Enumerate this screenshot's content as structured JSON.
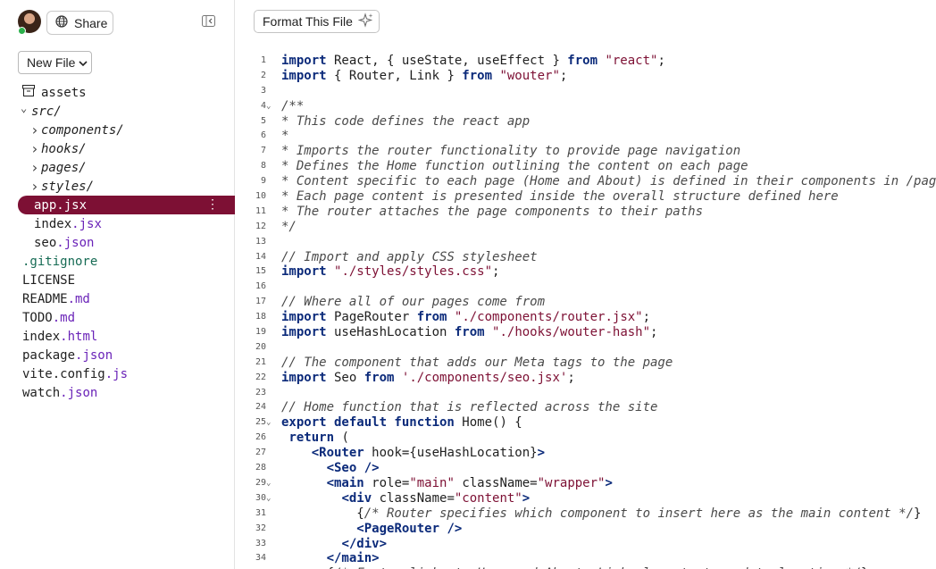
{
  "sidebar": {
    "share_label": "Share",
    "new_file_label": "New File",
    "tree": [
      {
        "indent": 0,
        "type": "dir-icon",
        "name": "assets",
        "ext": ""
      },
      {
        "indent": 0,
        "type": "open-folder",
        "name": "src/",
        "ext": ""
      },
      {
        "indent": 1,
        "type": "closed-folder",
        "name": "components/",
        "ext": ""
      },
      {
        "indent": 1,
        "type": "closed-folder",
        "name": "hooks/",
        "ext": ""
      },
      {
        "indent": 1,
        "type": "closed-folder",
        "name": "pages/",
        "ext": ""
      },
      {
        "indent": 1,
        "type": "closed-folder",
        "name": "styles/",
        "ext": ""
      },
      {
        "indent": 1,
        "type": "selected",
        "name": "app",
        "ext": ".jsx"
      },
      {
        "indent": 1,
        "type": "file",
        "name": "index",
        "ext": ".jsx"
      },
      {
        "indent": 1,
        "type": "file",
        "name": "seo",
        "ext": ".json"
      },
      {
        "indent": 0,
        "type": "gitignore",
        "name": ".gitignore",
        "ext": ""
      },
      {
        "indent": 0,
        "type": "file",
        "name": "LICENSE",
        "ext": ""
      },
      {
        "indent": 0,
        "type": "file",
        "name": "README",
        "ext": ".md"
      },
      {
        "indent": 0,
        "type": "file",
        "name": "TODO",
        "ext": ".md"
      },
      {
        "indent": 0,
        "type": "file",
        "name": "index",
        "ext": ".html"
      },
      {
        "indent": 0,
        "type": "file",
        "name": "package",
        "ext": ".json"
      },
      {
        "indent": 0,
        "type": "file",
        "name": "vite.config",
        "ext": ".js"
      },
      {
        "indent": 0,
        "type": "file",
        "name": "watch",
        "ext": ".json"
      }
    ]
  },
  "editor": {
    "format_label": "Format This File",
    "lines": [
      {
        "n": "1",
        "fold": "",
        "tokens": [
          [
            "kw",
            "import"
          ],
          [
            "",
            "  React, { useState, useEffect } "
          ],
          [
            "kw",
            "from"
          ],
          [
            "",
            " "
          ],
          [
            "str",
            "\"react\""
          ],
          [
            "",
            ";"
          ]
        ]
      },
      {
        "n": "2",
        "fold": "",
        "tokens": [
          [
            "kw",
            "import"
          ],
          [
            "",
            " { Router, Link } "
          ],
          [
            "kw",
            "from"
          ],
          [
            "",
            " "
          ],
          [
            "str",
            "\"wouter\""
          ],
          [
            "",
            ";"
          ]
        ]
      },
      {
        "n": "3",
        "fold": "",
        "tokens": []
      },
      {
        "n": "4",
        "fold": "v",
        "tokens": [
          [
            "cm",
            "/**"
          ]
        ]
      },
      {
        "n": "5",
        "fold": "",
        "tokens": [
          [
            "cm",
            "* This code defines the react app"
          ]
        ]
      },
      {
        "n": "6",
        "fold": "",
        "tokens": [
          [
            "cm",
            "*"
          ]
        ]
      },
      {
        "n": "7",
        "fold": "",
        "tokens": [
          [
            "cm",
            "* Imports the router functionality to provide page navigation"
          ]
        ]
      },
      {
        "n": "8",
        "fold": "",
        "tokens": [
          [
            "cm",
            "* Defines the Home function outlining the content on each page"
          ]
        ]
      },
      {
        "n": "9",
        "fold": "",
        "tokens": [
          [
            "cm",
            "* Content specific to each page (Home and About) is defined in their components in /pages"
          ]
        ]
      },
      {
        "n": "10",
        "fold": "",
        "tokens": [
          [
            "cm",
            "* Each page content is presented inside the overall structure defined here"
          ]
        ]
      },
      {
        "n": "11",
        "fold": "",
        "tokens": [
          [
            "cm",
            "* The router attaches the page components to their paths"
          ]
        ]
      },
      {
        "n": "12",
        "fold": "",
        "tokens": [
          [
            "cm",
            "*/"
          ]
        ]
      },
      {
        "n": "13",
        "fold": "",
        "tokens": []
      },
      {
        "n": "14",
        "fold": "",
        "tokens": [
          [
            "cm",
            "// Import and apply CSS stylesheet"
          ]
        ]
      },
      {
        "n": "15",
        "fold": "",
        "tokens": [
          [
            "kw",
            "import"
          ],
          [
            "",
            " "
          ],
          [
            "str",
            "\"./styles/styles.css\""
          ],
          [
            "",
            ";"
          ]
        ]
      },
      {
        "n": "16",
        "fold": "",
        "tokens": []
      },
      {
        "n": "17",
        "fold": "",
        "tokens": [
          [
            "cm",
            "// Where all of our pages come from"
          ]
        ]
      },
      {
        "n": "18",
        "fold": "",
        "tokens": [
          [
            "kw",
            "import"
          ],
          [
            "",
            " PageRouter "
          ],
          [
            "kw",
            "from"
          ],
          [
            "",
            " "
          ],
          [
            "str",
            "\"./components/router.jsx\""
          ],
          [
            "",
            ";"
          ]
        ]
      },
      {
        "n": "19",
        "fold": "",
        "tokens": [
          [
            "kw",
            "import"
          ],
          [
            "",
            " useHashLocation "
          ],
          [
            "kw",
            "from"
          ],
          [
            "",
            " "
          ],
          [
            "str",
            "\"./hooks/wouter-hash\""
          ],
          [
            "",
            ";"
          ]
        ]
      },
      {
        "n": "20",
        "fold": "",
        "tokens": []
      },
      {
        "n": "21",
        "fold": "",
        "tokens": [
          [
            "cm",
            "// The component that adds our Meta tags to the page"
          ]
        ]
      },
      {
        "n": "22",
        "fold": "",
        "tokens": [
          [
            "kw",
            "import"
          ],
          [
            "",
            " Seo "
          ],
          [
            "kw",
            "from"
          ],
          [
            "",
            " "
          ],
          [
            "str",
            "'./components/seo.jsx'"
          ],
          [
            "",
            ";"
          ]
        ]
      },
      {
        "n": "23",
        "fold": "",
        "tokens": []
      },
      {
        "n": "24",
        "fold": "",
        "tokens": [
          [
            "cm",
            "// Home function that is reflected across the site"
          ]
        ]
      },
      {
        "n": "25",
        "fold": "v",
        "tokens": [
          [
            "kw",
            "export default function"
          ],
          [
            "",
            " Home() {"
          ]
        ]
      },
      {
        "n": "26",
        "fold": "",
        "tokens": [
          [
            "",
            " "
          ],
          [
            "kw",
            "return"
          ],
          [
            "",
            " ("
          ]
        ]
      },
      {
        "n": "27",
        "fold": "",
        "tokens": [
          [
            "",
            "    "
          ],
          [
            "tag",
            "<Router"
          ],
          [
            "",
            " hook={useHashLocation}"
          ],
          [
            "tag",
            ">"
          ]
        ]
      },
      {
        "n": "28",
        "fold": "",
        "tokens": [
          [
            "",
            "      "
          ],
          [
            "tag",
            "<Seo />"
          ]
        ]
      },
      {
        "n": "29",
        "fold": "v",
        "tokens": [
          [
            "",
            "      "
          ],
          [
            "tag",
            "<main"
          ],
          [
            "",
            " role="
          ],
          [
            "str",
            "\"main\""
          ],
          [
            "",
            " className="
          ],
          [
            "str",
            "\"wrapper\""
          ],
          [
            "tag",
            ">"
          ]
        ]
      },
      {
        "n": "30",
        "fold": "v",
        "tokens": [
          [
            "",
            "        "
          ],
          [
            "tag",
            "<div"
          ],
          [
            "",
            " className="
          ],
          [
            "str",
            "\"content\""
          ],
          [
            "tag",
            ">"
          ]
        ]
      },
      {
        "n": "31",
        "fold": "",
        "tokens": [
          [
            "",
            "          {"
          ],
          [
            "cm",
            "/* Router specifies which component to insert here as the main content */"
          ],
          [
            "",
            "}"
          ]
        ]
      },
      {
        "n": "32",
        "fold": "",
        "tokens": [
          [
            "",
            "          "
          ],
          [
            "tag",
            "<PageRouter />"
          ]
        ]
      },
      {
        "n": "33",
        "fold": "",
        "tokens": [
          [
            "",
            "        "
          ],
          [
            "tag",
            "</div>"
          ]
        ]
      },
      {
        "n": "34",
        "fold": "",
        "tokens": [
          [
            "",
            "      "
          ],
          [
            "tag",
            "</main>"
          ]
        ]
      },
      {
        "n": "35",
        "fold": "",
        "tokens": [
          [
            "",
            "      {"
          ],
          [
            "cm",
            "/* Footer links to Home and About, Link elements to update location */"
          ],
          [
            "",
            "}"
          ]
        ]
      }
    ]
  }
}
